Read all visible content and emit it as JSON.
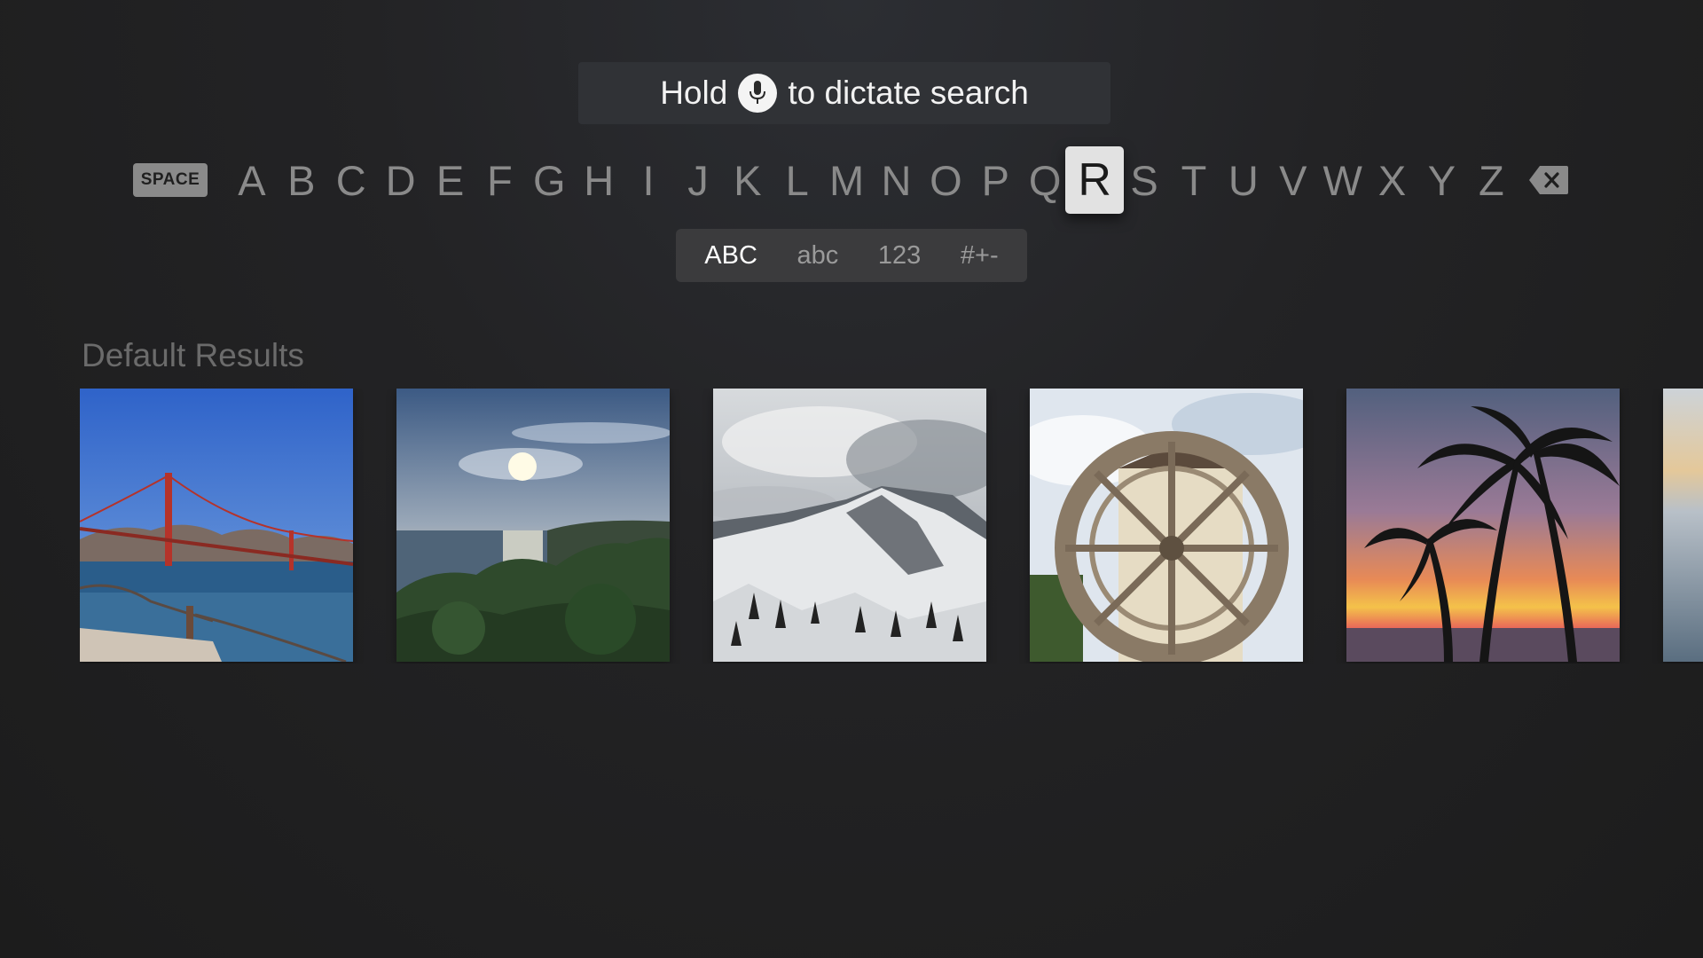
{
  "dictation": {
    "before": "Hold",
    "after": "to dictate search",
    "icon": "microphone-icon"
  },
  "keyboard": {
    "space_label": "SPACE",
    "letters": [
      "A",
      "B",
      "C",
      "D",
      "E",
      "F",
      "G",
      "H",
      "I",
      "J",
      "K",
      "L",
      "M",
      "N",
      "O",
      "P",
      "Q",
      "R",
      "S",
      "T",
      "U",
      "V",
      "W",
      "X",
      "Y",
      "Z"
    ],
    "focused": "R",
    "delete_icon": "delete-backspace-icon"
  },
  "modes": [
    {
      "label": "ABC",
      "active": true
    },
    {
      "label": "abc",
      "active": false
    },
    {
      "label": "123",
      "active": false
    },
    {
      "label": "#+-",
      "active": false
    }
  ],
  "results": {
    "title": "Default Results",
    "items": [
      {
        "name": "golden-gate-bridge-photo"
      },
      {
        "name": "ocean-sunset-coast-photo"
      },
      {
        "name": "snowy-mountain-photo"
      },
      {
        "name": "water-wheel-photo"
      },
      {
        "name": "palm-trees-sunset-photo"
      },
      {
        "name": "ocean-partial-photo"
      }
    ]
  }
}
